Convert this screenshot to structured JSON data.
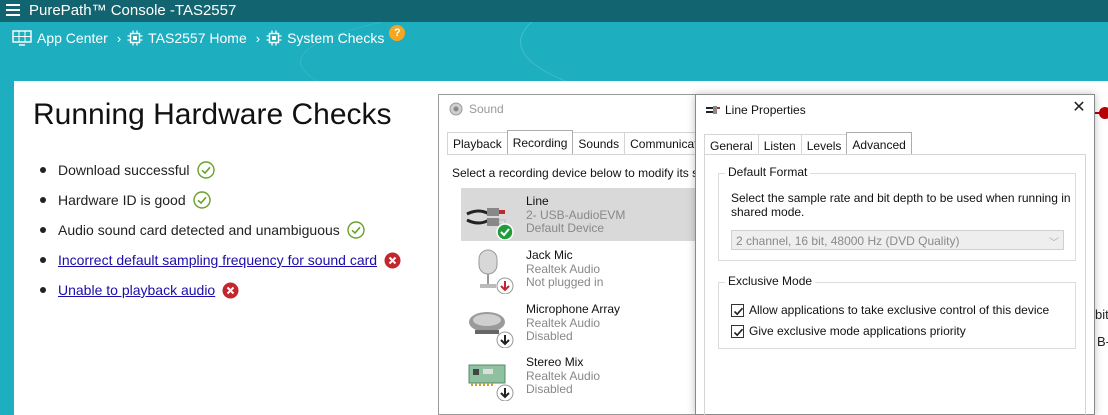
{
  "app": {
    "title": "PurePath™ Console -TAS2557"
  },
  "breadcrumb": {
    "items": [
      {
        "label": "App Center",
        "icon": "monitor-grid-icon"
      },
      {
        "label": "TAS2557 Home",
        "icon": "chip-icon"
      },
      {
        "label": "System Checks",
        "icon": "chip-icon"
      }
    ],
    "help_label": "?"
  },
  "main": {
    "heading": "Running Hardware Checks",
    "checks": [
      {
        "label": "Download successful",
        "status": "ok",
        "link": false
      },
      {
        "label": "Hardware ID is good",
        "status": "ok",
        "link": false
      },
      {
        "label": "Audio sound card detected and unambiguous",
        "status": "ok",
        "link": false
      },
      {
        "label": "Incorrect default sampling frequency for sound card",
        "status": "error",
        "link": true
      },
      {
        "label": "Unable to playback audio",
        "status": "error",
        "link": true
      }
    ]
  },
  "sound_dialog": {
    "title": "Sound",
    "tabs": [
      "Playback",
      "Recording",
      "Sounds",
      "Communications"
    ],
    "active_tab": "Recording",
    "instruction": "Select a recording device below to modify its s",
    "devices": [
      {
        "name": "Line",
        "sub": "2- USB-AudioEVM",
        "status": "Default Device",
        "selected": true,
        "badge": "check",
        "icon": "line-cable-icon"
      },
      {
        "name": "Jack Mic",
        "sub": "Realtek Audio",
        "status": "Not plugged in",
        "selected": false,
        "badge": "unplugged",
        "icon": "microphone-icon"
      },
      {
        "name": "Microphone Array",
        "sub": "Realtek Audio",
        "status": "Disabled",
        "selected": false,
        "badge": "disabled",
        "icon": "mic-array-icon"
      },
      {
        "name": "Stereo Mix",
        "sub": "Realtek Audio",
        "status": "Disabled",
        "selected": false,
        "badge": "disabled",
        "icon": "sound-card-icon"
      }
    ]
  },
  "line_properties": {
    "title": "Line Properties",
    "tabs": [
      "General",
      "Listen",
      "Levels",
      "Advanced"
    ],
    "active_tab": "Advanced",
    "default_format": {
      "label": "Default Format",
      "description": "Select the sample rate and bit depth to be used when running in shared mode.",
      "selected_value": "2 channel, 16 bit, 48000 Hz (DVD Quality)"
    },
    "exclusive_mode": {
      "label": "Exclusive Mode",
      "options": [
        {
          "label": "Allow applications to take exclusive control of this device",
          "checked": true
        },
        {
          "label": "Give exclusive mode applications priority",
          "checked": true
        }
      ]
    }
  },
  "background_fragments": {
    "frag1": "bit,",
    "frag2": "B-"
  },
  "colors": {
    "topbar": "#126470",
    "banner": "#1dafbf",
    "link": "#1a0dab",
    "ok": "#6aa02c",
    "error": "#c1272d",
    "help": "#f5a623",
    "check_badge": "#1e9e3a"
  }
}
